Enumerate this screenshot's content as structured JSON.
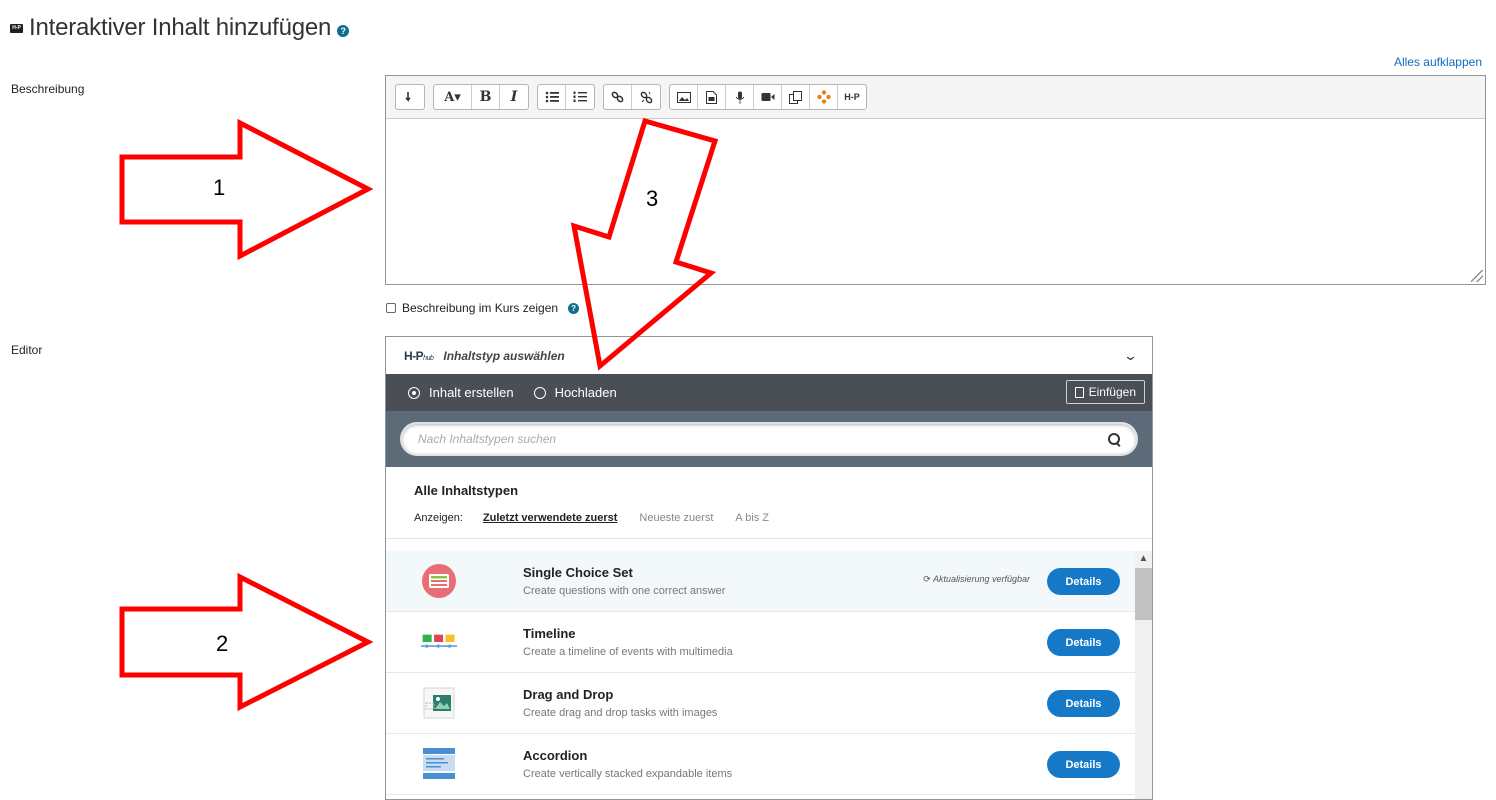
{
  "page": {
    "title": "Interaktiver Inhalt hinzufügen",
    "badge": "H-P",
    "help": "?",
    "expand_all": "Alles aufklappen"
  },
  "description": {
    "label": "Beschreibung",
    "toolbar": {
      "font_btn": "A▾",
      "bold": "B",
      "italic": "I",
      "h5p_btn": "H-P"
    },
    "show_in_course": "Beschreibung im Kurs zeigen"
  },
  "editor": {
    "label": "Editor",
    "hub_logo": "H-P",
    "hub_logo_sub": "hub",
    "hub_title": "Inhaltstyp auswählen",
    "tabs": [
      {
        "label": "Inhalt erstellen",
        "selected": true
      },
      {
        "label": "Hochladen",
        "selected": false
      }
    ],
    "paste_label": "Einfügen",
    "search_placeholder": "Nach Inhaltstypen suchen",
    "all_types": "Alle Inhaltstypen",
    "sort": {
      "label": "Anzeigen:",
      "options": [
        "Zuletzt verwendete zuerst",
        "Neueste zuerst",
        "A bis Z"
      ],
      "active": "Zuletzt verwendete zuerst"
    },
    "items": [
      {
        "title": "Single Choice Set",
        "desc": "Create questions with one correct answer",
        "update": "Aktualisierung verfügbar",
        "button": "Details"
      },
      {
        "title": "Timeline",
        "desc": "Create a timeline of events with multimedia",
        "button": "Details"
      },
      {
        "title": "Drag and Drop",
        "desc": "Create drag and drop tasks with images",
        "button": "Details"
      },
      {
        "title": "Accordion",
        "desc": "Create vertically stacked expandable items",
        "button": "Details"
      }
    ]
  },
  "annotations": {
    "arrow_1": "1",
    "arrow_2": "2",
    "arrow_3": "3",
    "arrow_color": "#ff0000"
  },
  "colors": {
    "accent": "#1679c8",
    "link": "#0f6cbf",
    "hub_tab_bg": "#4a4f55",
    "hub_search_bg": "#5d6a78"
  }
}
